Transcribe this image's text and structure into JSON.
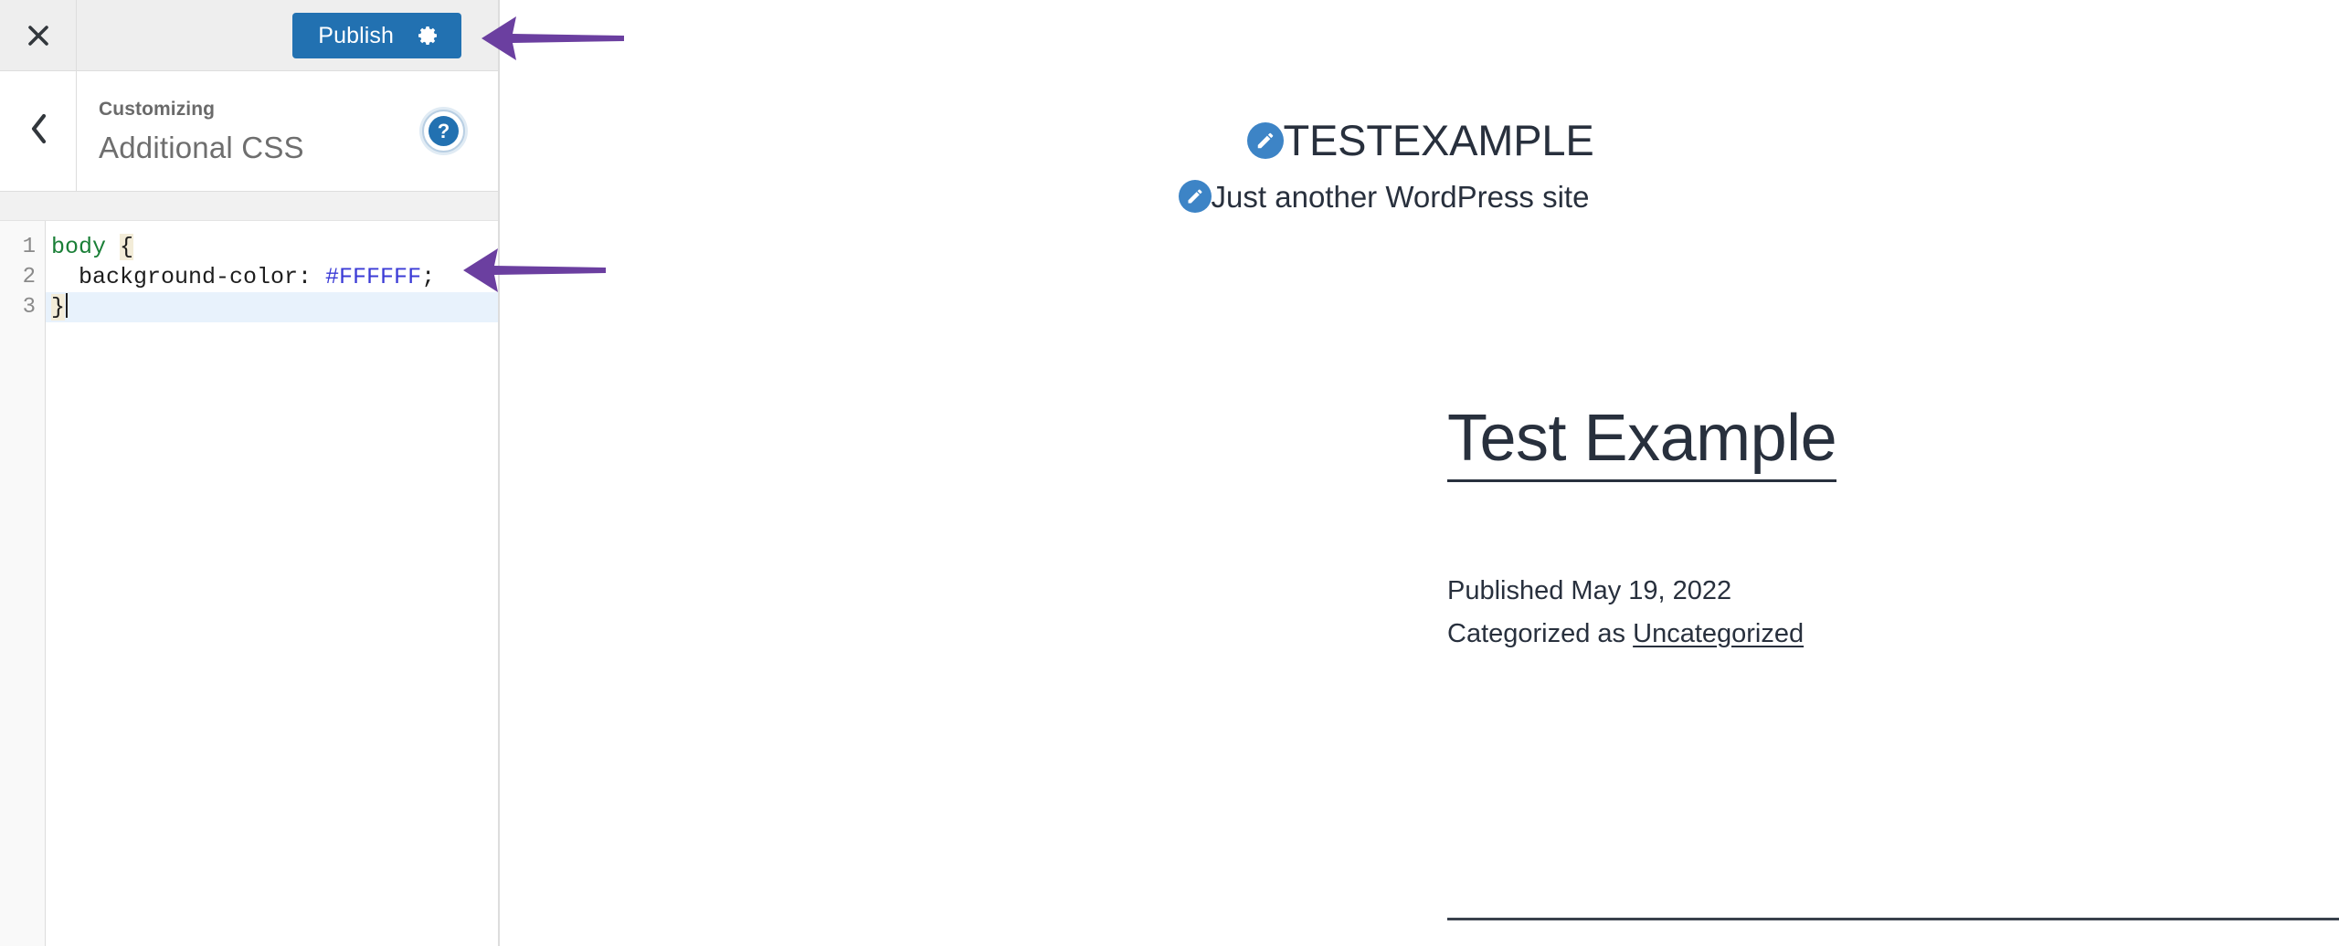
{
  "customizer": {
    "close_icon": "close-x-icon",
    "back_icon": "chevron-left-icon",
    "publish_label": "Publish",
    "publish_gear_icon": "gear-icon",
    "eyebrow": "Customizing",
    "title": "Additional CSS",
    "help_icon": "help-question-icon",
    "help_glyph": "?",
    "accent_color": "#2271b1"
  },
  "editor": {
    "line_numbers": [
      "1",
      "2",
      "3"
    ],
    "lines": [
      {
        "selector": "body",
        "brace": "{"
      },
      {
        "property": "  background-color:",
        "value": " #FFFFFF",
        "punct": ";"
      },
      {
        "brace": "}"
      }
    ],
    "raw_css": "body {\n  background-color: #FFFFFF;\n}",
    "active_line": "3",
    "selector_color": "#1a7f37",
    "value_color": "#3b3bd6",
    "active_line_color": "#e8f2fc"
  },
  "preview": {
    "site_title": "TESTEXAMPLE",
    "site_tagline": "Just another WordPress site",
    "edit_icon": "pencil-edit-icon",
    "post": {
      "title": "Test Example",
      "published_text": "Published May 19, 2022",
      "category_prefix": "Categorized as ",
      "category_link": "Uncategorized"
    }
  },
  "annotations": {
    "arrow_color": "#6b3fa0",
    "arrow_publish": "arrow-pointing-to-publish-button",
    "arrow_css": "arrow-pointing-to-css-code"
  }
}
